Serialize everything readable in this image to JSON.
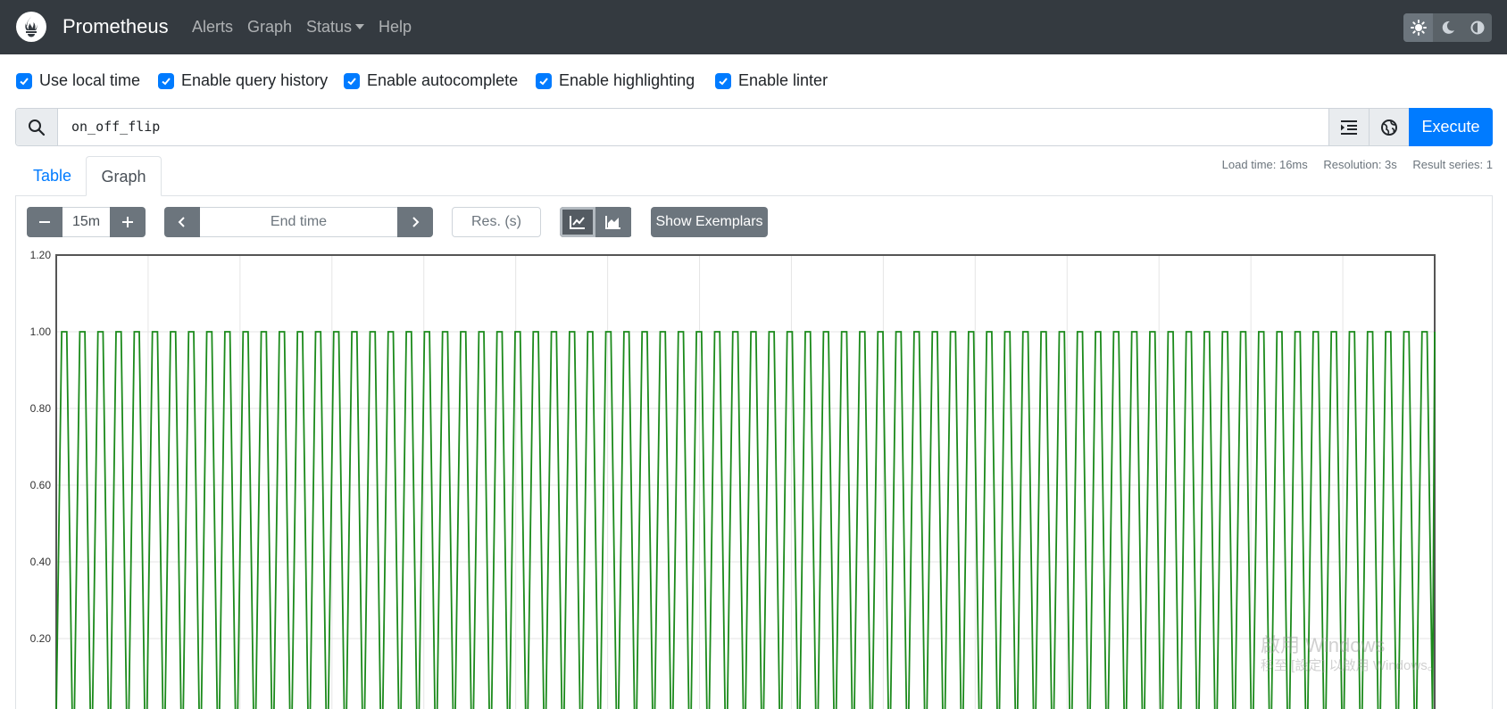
{
  "navbar": {
    "brand": "Prometheus",
    "links": [
      "Alerts",
      "Graph",
      "Status",
      "Help"
    ],
    "theme_buttons": [
      "sun-icon",
      "moon-icon",
      "contrast-icon"
    ]
  },
  "options": [
    {
      "label": "Use local time",
      "checked": true
    },
    {
      "label": "Enable query history",
      "checked": true
    },
    {
      "label": "Enable autocomplete",
      "checked": true
    },
    {
      "label": "Enable highlighting",
      "checked": true
    },
    {
      "label": "Enable linter",
      "checked": true
    }
  ],
  "query": {
    "value": "on_off_flip",
    "execute_label": "Execute"
  },
  "stats": {
    "load_time": "Load time: 16ms",
    "resolution": "Resolution: 3s",
    "result_series": "Result series: 1"
  },
  "tabs": {
    "table": "Table",
    "graph": "Graph",
    "active": "Graph"
  },
  "controls": {
    "range": "15m",
    "end_time_placeholder": "End time",
    "resolution_placeholder": "Res. (s)",
    "exemplars_label": "Show Exemplars",
    "chart_mode": "line"
  },
  "watermark": {
    "line1": "啟用 Windows",
    "line2": "移至 [設定] 以啟用 Windows。"
  },
  "colors": {
    "navbar": "#343a40",
    "primary": "#007bff",
    "series": "#1b8a1b"
  },
  "chart_data": {
    "type": "line",
    "title": "",
    "xlabel": "",
    "ylabel": "",
    "ylim": [
      0,
      1.2
    ],
    "yticks": [
      "1.20",
      "1.00",
      "0.80",
      "0.60",
      "0.40",
      "0.20"
    ],
    "series": [
      {
        "label": "on_off_flip",
        "pattern": "square wave alternating between 0 and 1",
        "high": 1,
        "low": 0,
        "pulse_count": 76
      }
    ]
  }
}
